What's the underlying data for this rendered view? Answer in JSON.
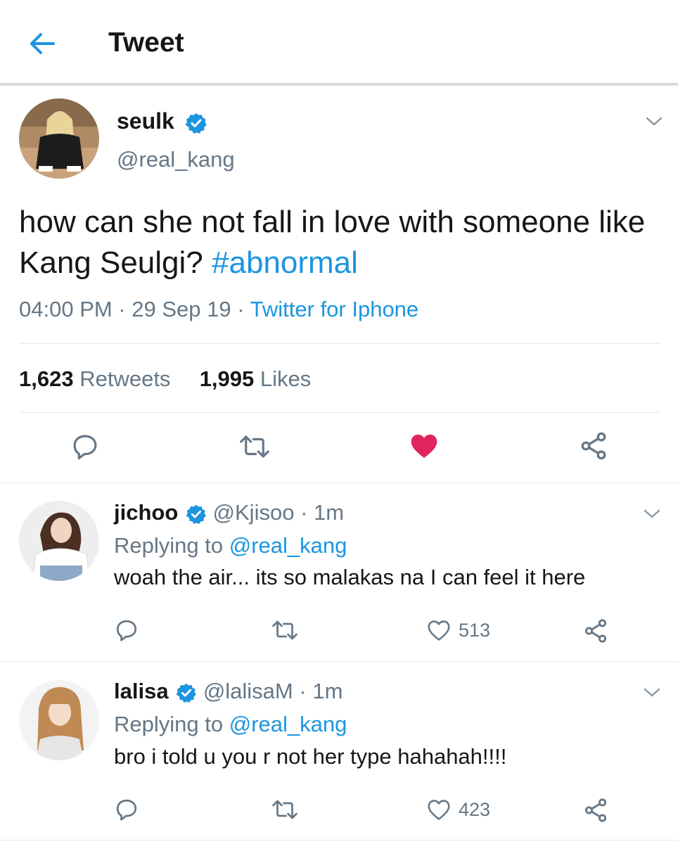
{
  "header": {
    "title": "Tweet"
  },
  "tweet": {
    "display_name": "seulk",
    "handle": "@real_kang",
    "text_plain": "how can she not fall in love with someone like Kang Seulgi? ",
    "hashtag": "#abnormal",
    "time": "04:00 PM",
    "date": "29 Sep 19",
    "source": "Twitter for Iphone",
    "separator": "·",
    "retweets_count": "1,623",
    "retweets_label": "Retweets",
    "likes_count": "1,995",
    "likes_label": "Likes",
    "liked": true
  },
  "replies": [
    {
      "display_name": "jichoo",
      "handle": "@Kjisoo",
      "time": "1m",
      "replying_label": "Replying to",
      "replying_to": "@real_kang",
      "text": "woah the air... its so malakas na I can feel it here",
      "likes": "513"
    },
    {
      "display_name": "lalisa",
      "handle": "@lalisaM",
      "time": "1m",
      "replying_label": "Replying to",
      "replying_to": "@real_kang",
      "text": "bro i told u you r not her type hahahah!!!!",
      "likes": "423"
    }
  ],
  "colors": {
    "accent": "#1b95e0",
    "like_active": "#e0245e",
    "text_secondary": "#657786",
    "divider": "#e1e8ed"
  },
  "icons": [
    "back-arrow-icon",
    "verified-badge-icon",
    "chevron-down-icon",
    "reply-icon",
    "retweet-icon",
    "heart-icon",
    "share-icon"
  ]
}
